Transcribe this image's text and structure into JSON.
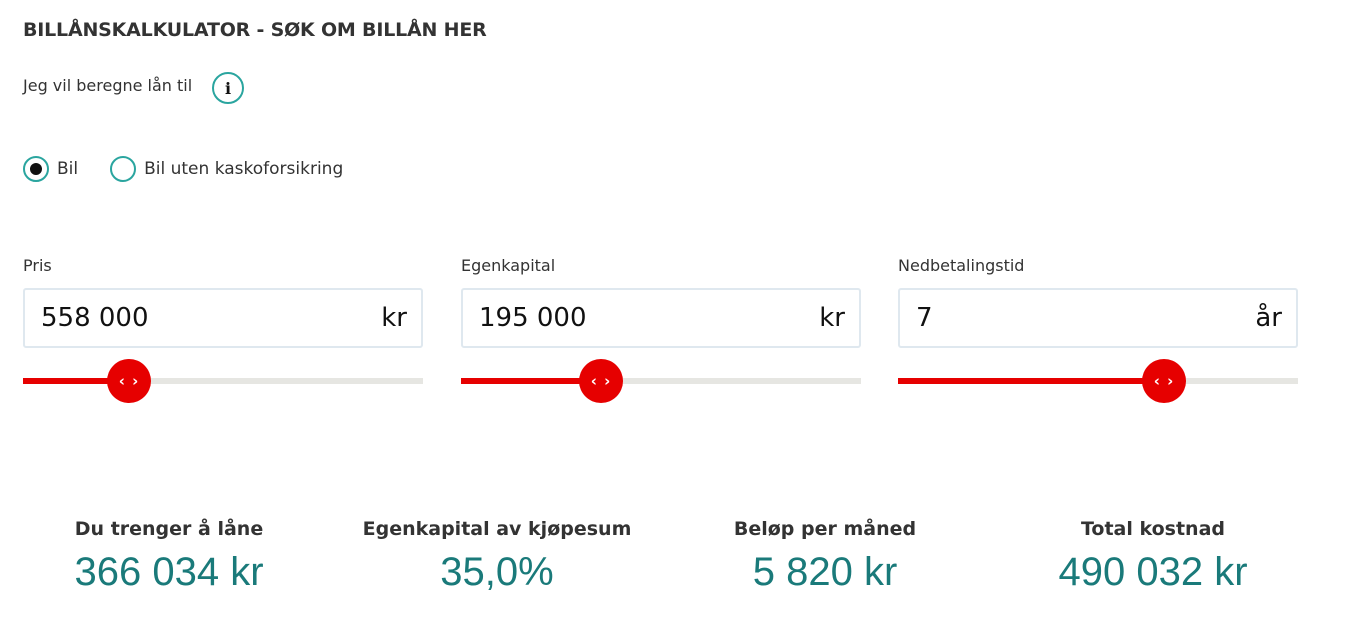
{
  "title": "BILLÅNSKALKULATOR - SØK OM BILLÅN HER",
  "lead_text": "Jeg vil beregne lån til",
  "info_icon": "i",
  "colors": {
    "accent": "#e60000",
    "teal": "#2aa59f",
    "result_teal": "#1a7a7a"
  },
  "loan_type": {
    "options": [
      {
        "label": "Bil",
        "selected": true
      },
      {
        "label": "Bil uten kaskoforsikring",
        "selected": false
      }
    ]
  },
  "fields": [
    {
      "label": "Pris",
      "value": "558 000",
      "unit": "kr",
      "slider_percent": 26.5,
      "handle_glyph": "‹ ›"
    },
    {
      "label": "Egenkapital",
      "value": "195 000",
      "unit": "kr",
      "slider_percent": 35.0,
      "handle_glyph": "‹ ›"
    },
    {
      "label": "Nedbetalingstid",
      "value": "7",
      "unit": "år",
      "slider_percent": 66.5,
      "handle_glyph": "‹ ›"
    }
  ],
  "results": [
    {
      "label": "Du trenger å låne",
      "value": "366 034 kr"
    },
    {
      "label": "Egenkapital av kjøpesum",
      "value": "35,0%"
    },
    {
      "label": "Beløp per måned",
      "value": "5 820 kr"
    },
    {
      "label": "Total kostnad",
      "value": "490 032 kr"
    }
  ]
}
